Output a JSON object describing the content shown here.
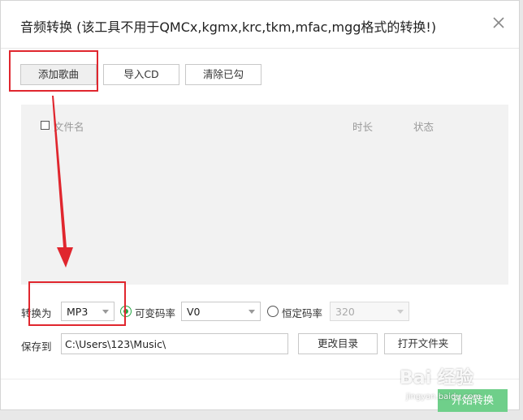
{
  "dialog": {
    "title": "音频转换 (该工具不用于QMCx,kgmx,krc,tkm,mfac,mgg格式的转换!)",
    "close_icon": "close-icon"
  },
  "toolbar": {
    "add_song": "添加歌曲",
    "import_cd": "导入CD",
    "clear_checked": "清除已勾"
  },
  "file_list": {
    "columns": [
      "文件名",
      "时长",
      "状态"
    ],
    "rows": []
  },
  "convert": {
    "label": "转换为",
    "format": "MP3",
    "vbr_label": "可变码率",
    "vbr_value": "V0",
    "cbr_label": "恒定码率",
    "cbr_value": "320",
    "selected_mode": "vbr"
  },
  "save": {
    "label": "保存到",
    "path": "C:\\Users\\123\\Music\\",
    "change_dir": "更改目录",
    "open_folder": "打开文件夹"
  },
  "footer": {
    "start_button": "开始转换"
  },
  "watermark": {
    "logo": "Bai 经验",
    "url": "jingyan.baidu.com"
  },
  "colors": {
    "accent_green": "#27a745",
    "highlight_red": "#e0262e",
    "start_button_bg": "#6fcf8a"
  }
}
